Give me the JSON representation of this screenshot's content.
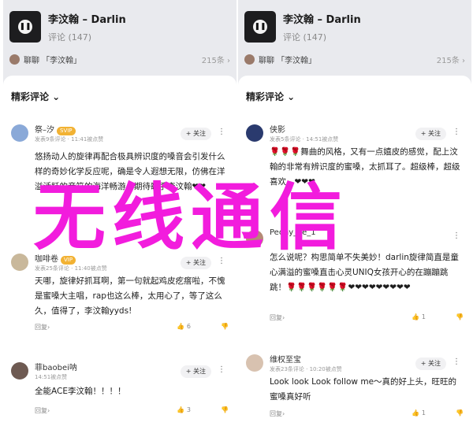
{
  "left": {
    "song": {
      "title": "李汶翰 – Darlin",
      "comments": "评论 (147)",
      "play_icon": "pause-icon"
    },
    "chat": {
      "text": "聊聊",
      "tag": "「李汶翰」",
      "count": "215条 ›"
    },
    "sheet": {
      "heading": "精彩评论 ⌄"
    },
    "comments": [
      {
        "name": "祭–汐",
        "vip": "SVIP",
        "meta": "发表9条评论 · 11:41被点赞",
        "follow": "+ 关注",
        "text": "悠扬动人的旋律再配合极具辨识度的嗓音会引发什么样的奇妙化学反应呢，确是令人遐想无限，仿佛在洋溢活跃的音符的海洋畅游，期待歌手李汶翰❤❤",
        "reply": "回复›",
        "likes": "",
        "avatar_color": "#8aa9d8"
      },
      {
        "name": "咖啡卷",
        "vip": "VIP",
        "meta": "发表25条评论 · 11:40被点赞",
        "follow": "+ 关注",
        "text": "天哪，旋律好抓耳啊，第一句就起鸡皮疙瘩啦，不愧是蜜嗓大主唱，rap也这么棒，太用心了，等了这么久，值得了，李汶翰yyds!",
        "reply": "回复›",
        "likes": "6",
        "avatar_color": "#c9b89b"
      },
      {
        "name": "菲baobei呐",
        "vip": "",
        "meta": "14:51被点赞",
        "follow": "+ 关注",
        "text": "全能ACE李汶翰！！！！",
        "reply": "回复›",
        "likes": "3",
        "avatar_color": "#6e5a52"
      }
    ]
  },
  "right": {
    "song": {
      "title": "李汶翰 – Darlin",
      "comments": "评论 (147)",
      "play_icon": "pause-icon"
    },
    "chat": {
      "text": "聊聊",
      "tag": "「李汶翰」",
      "count": "215条 ›"
    },
    "sheet": {
      "heading": "精彩评论 ⌄"
    },
    "comments": [
      {
        "name": "侠影",
        "vip": "",
        "meta": "发表5条评论 · 14:51被点赞",
        "follow": "+ 关注",
        "text": "🌹🌹🌹舞曲的风格，又有一点嬉皮的感觉，配上汶翰的非常有辨识度的蜜嗓，太抓耳了。超级棒，超级喜欢。❤❤❤",
        "reply": "",
        "likes": "",
        "avatar_color": "#2a3a6e"
      },
      {
        "name": "Peony_ve_1",
        "vip": "",
        "meta": "",
        "follow": "",
        "text": "怎么说呢？构思简单不失美妙！darlin旋律简直是童心满溢的蜜嗓直击心灵UNIQ女孩开心的在蹦蹦跳跳！🌹🌹🌹🌹🌹🌹❤❤❤❤❤❤❤❤❤",
        "reply": "回复›",
        "likes": "1",
        "avatar_color": "#b58a76"
      },
      {
        "name": "维权至宝",
        "vip": "",
        "meta": "发表23条评论 · 10:20被点赞",
        "follow": "+ 关注",
        "text": "Look look Look follow me～真的好上头，旺旺的蜜嗓真好听",
        "reply": "回复›",
        "likes": "1",
        "avatar_color": "#d8c2b0"
      }
    ]
  },
  "overlay_text": "无线通信",
  "colors": {
    "overlay": "#f21cdd",
    "vip": "#f2b233",
    "sheet": "#ffffff",
    "panel": "#e9eaee"
  }
}
